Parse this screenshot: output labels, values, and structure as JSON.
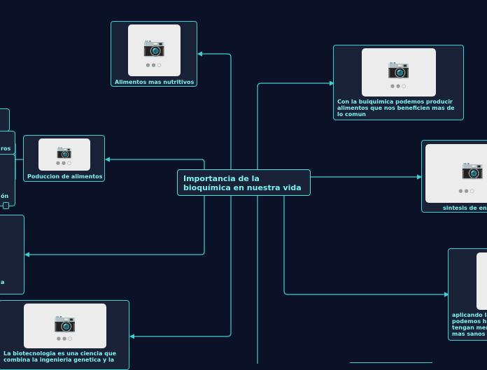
{
  "map": {
    "central": "Importancia de la bioquímica en nuestra vida",
    "nodes": {
      "nutritivos": "Alimentos mas nutritivos",
      "beneficien": "Con la buiquimica podemos producir alimentos que nos beneficien mas de lo comun",
      "produccion": "Poduccion de alimentos",
      "enzimas": "sintesis de enz",
      "aplicando": "aplicando la podemos h tengan men mas sanos",
      "biotecnologia": "La biotecnologia es una ciencia que combina la ingenieria genetica y la",
      "left_a": "a",
      "left_ros": "ros",
      "left_on": "ón"
    }
  },
  "colors": {
    "background": "#0b1228",
    "node_fill": "#1a2238",
    "edge": "#3fcfd0",
    "text": "#7ef2f2"
  }
}
